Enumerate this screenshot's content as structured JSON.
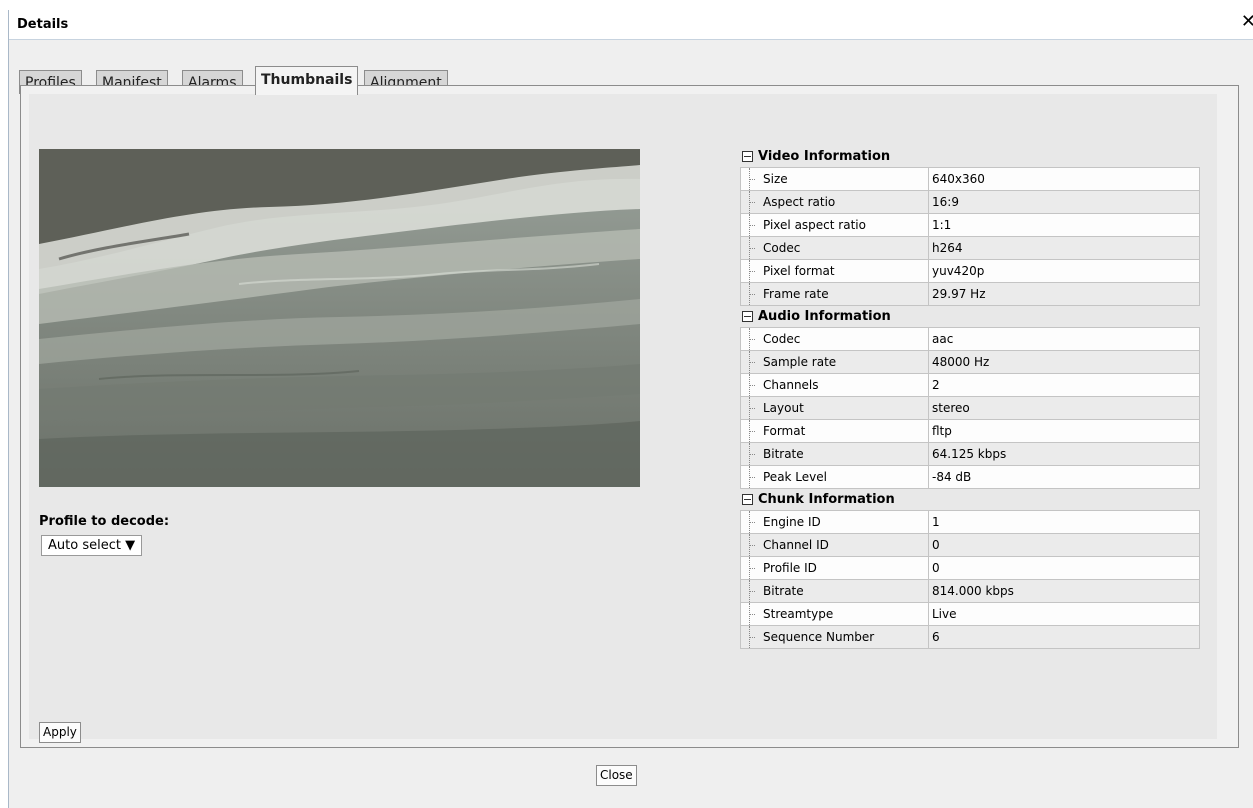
{
  "window": {
    "title": "Details",
    "close_glyph": "✕"
  },
  "tabs": [
    {
      "label": "Profiles"
    },
    {
      "label": "Manifest"
    },
    {
      "label": "Alarms"
    },
    {
      "label": "Thumbnails",
      "active": true
    },
    {
      "label": "Alignment"
    }
  ],
  "decode": {
    "label": "Profile to decode:",
    "selected": "Auto select ▼"
  },
  "apply_label": "Apply",
  "close_label": "Close",
  "video": {
    "title": "Video Information",
    "rows": [
      {
        "key": "Size",
        "value": "640x360"
      },
      {
        "key": "Aspect ratio",
        "value": "16:9"
      },
      {
        "key": "Pixel aspect ratio",
        "value": "1:1"
      },
      {
        "key": "Codec",
        "value": "h264"
      },
      {
        "key": "Pixel format",
        "value": "yuv420p"
      },
      {
        "key": "Frame rate",
        "value": "29.97 Hz"
      }
    ]
  },
  "audio": {
    "title": "Audio Information",
    "rows": [
      {
        "key": "Codec",
        "value": "aac"
      },
      {
        "key": "Sample rate",
        "value": "48000 Hz"
      },
      {
        "key": "Channels",
        "value": "2"
      },
      {
        "key": "Layout",
        "value": "stereo"
      },
      {
        "key": "Format",
        "value": "fltp"
      },
      {
        "key": "Bitrate",
        "value": "64.125 kbps"
      },
      {
        "key": "Peak Level",
        "value": "-84 dB"
      }
    ]
  },
  "chunk": {
    "title": "Chunk Information",
    "rows": [
      {
        "key": "Engine ID",
        "value": "1"
      },
      {
        "key": "Channel ID",
        "value": "0"
      },
      {
        "key": "Profile ID",
        "value": "0"
      },
      {
        "key": "Bitrate",
        "value": "814.000 kbps"
      },
      {
        "key": "Streamtype",
        "value": "Live"
      },
      {
        "key": "Sequence Number",
        "value": "6"
      }
    ]
  }
}
